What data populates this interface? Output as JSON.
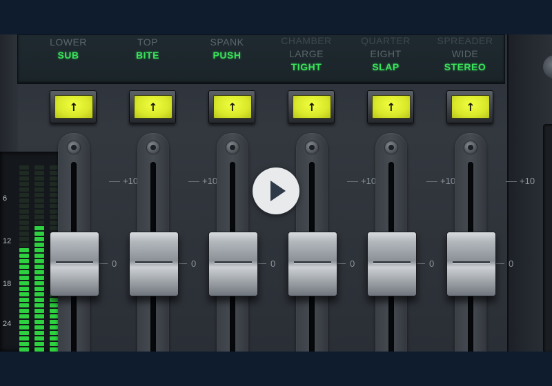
{
  "channels": [
    {
      "presets": [
        "",
        "LOWER",
        "SUB"
      ],
      "button_glyph": "↑",
      "tick_top": "+10",
      "tick_zero": "0",
      "fader_level": 0.35
    },
    {
      "presets": [
        "",
        "TOP",
        "BITE"
      ],
      "button_glyph": "↑",
      "tick_top": "+10",
      "tick_zero": "0",
      "fader_level": 0.35
    },
    {
      "presets": [
        "",
        "SPANK",
        "PUSH"
      ],
      "button_glyph": "↑",
      "tick_top": "+10",
      "tick_zero": "0",
      "fader_level": 0.35
    },
    {
      "presets": [
        "CHAMBER",
        "LARGE",
        "TIGHT"
      ],
      "button_glyph": "↑",
      "tick_top": "+10",
      "tick_zero": "0",
      "fader_level": 0.35
    },
    {
      "presets": [
        "QUARTER",
        "EIGHT",
        "SLAP"
      ],
      "button_glyph": "↑",
      "tick_top": "+10",
      "tick_zero": "0",
      "fader_level": 0.35
    },
    {
      "presets": [
        "SPREADER",
        "WIDE",
        "STEREO"
      ],
      "button_glyph": "↑",
      "tick_top": "+10",
      "tick_zero": "0",
      "fader_level": 0.35
    }
  ],
  "meter": {
    "ticks": [
      "6",
      "12",
      "18",
      "24"
    ]
  },
  "colors": {
    "active_preset": "#39e25a",
    "button": "#e3f22e",
    "meter_green": "#2ed13f"
  },
  "icons": {
    "play": "play-icon",
    "button": "arrow-up-icon"
  }
}
